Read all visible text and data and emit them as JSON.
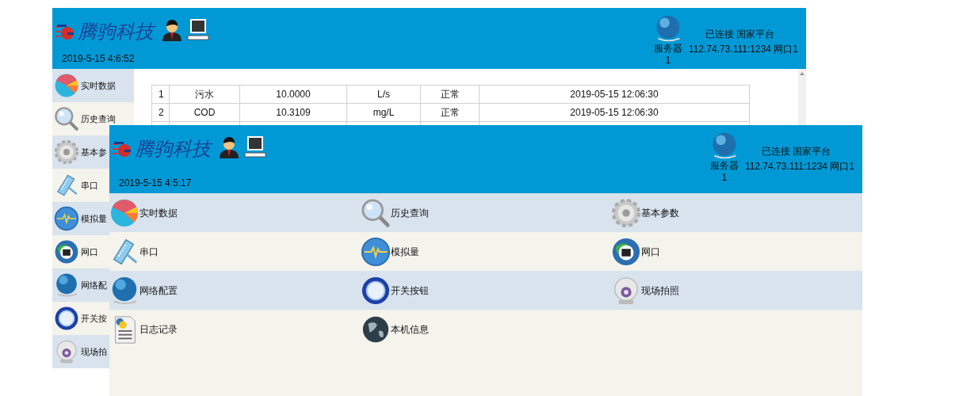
{
  "windows": [
    {
      "header": {
        "logo_text": "腾驹科技",
        "datetime": "2019-5-15 4:6:52",
        "server_label": "服务器",
        "server_index": "1",
        "status": "已连接 国家平台",
        "address": "112.74.73.111:1234 网口1"
      },
      "sidebar": [
        {
          "label": "实时数据",
          "kind": "realtime"
        },
        {
          "label": "历史查询",
          "kind": "history"
        },
        {
          "label": "基本参",
          "kind": "settings"
        },
        {
          "label": "串口",
          "kind": "serial"
        },
        {
          "label": "模拟量",
          "kind": "analog"
        },
        {
          "label": "网口",
          "kind": "ethernet"
        },
        {
          "label": "网络配",
          "kind": "network"
        },
        {
          "label": "开关按",
          "kind": "switch"
        },
        {
          "label": "现场拍",
          "kind": "camera"
        }
      ],
      "table": {
        "rows": [
          [
            "1",
            "污水",
            "10.0000",
            "L/s",
            "正常",
            "2019-05-15 12:06:30"
          ],
          [
            "2",
            "COD",
            "10.3109",
            "mg/L",
            "正常",
            "2019-05-15 12:06:30"
          ]
        ]
      }
    },
    {
      "header": {
        "logo_text": "腾驹科技",
        "datetime": "2019-5-15 4:5:17",
        "server_label": "服务器",
        "server_index": "1",
        "status": "已连接 国家平台",
        "address": "112.74.73.111:1234 网口1"
      },
      "menu": [
        {
          "label": "实时数据",
          "kind": "realtime"
        },
        {
          "label": "历史查询",
          "kind": "history"
        },
        {
          "label": "基本参数",
          "kind": "settings"
        },
        {
          "label": "串口",
          "kind": "serial"
        },
        {
          "label": "模拟量",
          "kind": "analog"
        },
        {
          "label": "网口",
          "kind": "ethernet"
        },
        {
          "label": "网络配置",
          "kind": "network"
        },
        {
          "label": "开关按钮",
          "kind": "switch"
        },
        {
          "label": "现场拍照",
          "kind": "camera"
        },
        {
          "label": "日志记录",
          "kind": "log"
        },
        {
          "label": "本机信息",
          "kind": "info"
        }
      ]
    }
  ]
}
